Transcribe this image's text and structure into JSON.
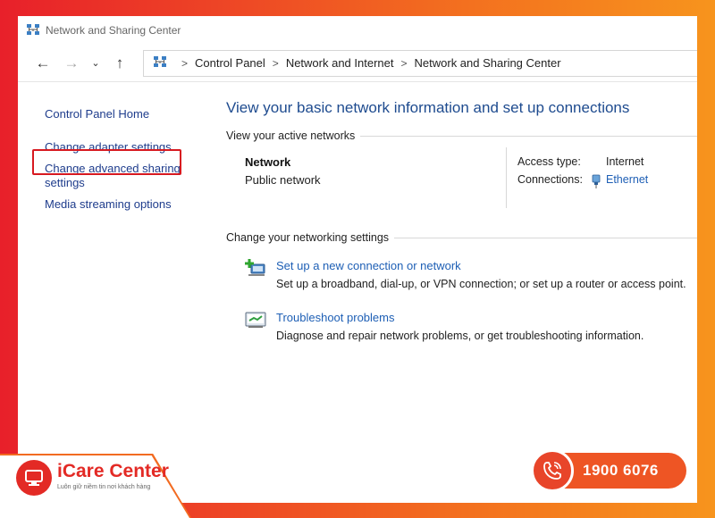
{
  "window": {
    "title": "Network and Sharing Center"
  },
  "address": {
    "breadcrumbs": [
      "Control Panel",
      "Network and Internet",
      "Network and Sharing Center"
    ],
    "separator": ">"
  },
  "nav_buttons": {
    "back": "←",
    "forward": "→",
    "recent": "⌄",
    "up": "↑"
  },
  "left_nav": {
    "home": "Control Panel Home",
    "adapter": "Change adapter settings",
    "advanced": "Change advanced sharing settings",
    "media": "Media streaming options"
  },
  "main": {
    "title": "View your basic network information and set up connections",
    "active_heading": "View your active networks",
    "network": {
      "name": "Network",
      "type": "Public network",
      "access_label": "Access type:",
      "access_value": "Internet",
      "connections_label": "Connections:",
      "connections_value": "Ethernet"
    },
    "change_heading": "Change your networking settings",
    "tasks": [
      {
        "link": "Set up a new connection or network",
        "desc": "Set up a broadband, dial-up, or VPN connection; or set up a router or access point."
      },
      {
        "link": "Troubleshoot problems",
        "desc": "Diagnose and repair network problems, or get troubleshooting information."
      }
    ]
  },
  "branding": {
    "name": "iCare Center",
    "tagline": "Luôn giữ niềm tin nơi khách hàng",
    "hotline": "1900 6076",
    "accent": "#e32a25",
    "orange": "#f7941d"
  }
}
